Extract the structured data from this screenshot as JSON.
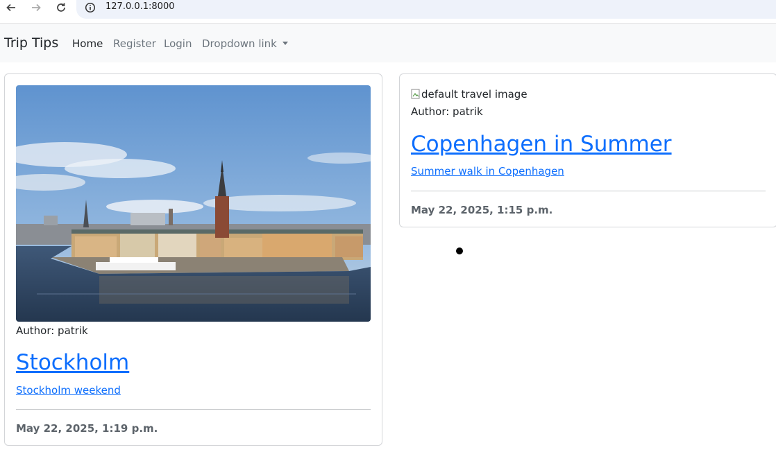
{
  "browser": {
    "url": "127.0.0.1:8000"
  },
  "navbar": {
    "brand": "Trip Tips",
    "links": [
      {
        "label": "Home",
        "active": true
      },
      {
        "label": "Register",
        "active": false
      },
      {
        "label": "Login",
        "active": false
      },
      {
        "label": "Dropdown link",
        "active": false
      }
    ]
  },
  "posts": [
    {
      "image_alt": "",
      "author": "Author: patrik",
      "title": "Stockholm",
      "subtitle": "Stockholm weekend",
      "date": "May 22, 2025, 1:19 p.m."
    },
    {
      "image_alt": "default travel image",
      "author": "Author: patrik",
      "title": "Copenhagen in Summer",
      "subtitle": "Summer walk in Copenhagen",
      "date": "May 22, 2025, 1:15 p.m."
    }
  ],
  "colors": {
    "link": "#0d6efd",
    "navbar_bg": "#f8f9fa",
    "muted": "#6c757d"
  }
}
